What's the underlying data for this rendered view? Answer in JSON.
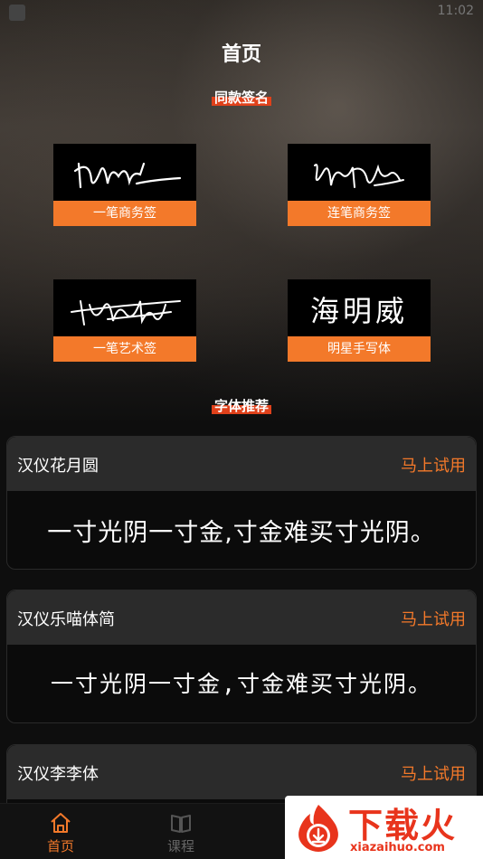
{
  "status": {
    "time": "11:02"
  },
  "header": {
    "title": "首页"
  },
  "signature_section": {
    "title": "同款签名",
    "cards": [
      {
        "label": "一笔商务签"
      },
      {
        "label": "连笔商务签"
      },
      {
        "label": "一笔艺术签"
      },
      {
        "label": "明星手写体",
        "sample_text": "海明威"
      }
    ]
  },
  "font_section": {
    "title": "字体推荐",
    "fonts": [
      {
        "name": "汉仪花月圆",
        "action": "马上试用",
        "sample": "一寸光阴一寸金,寸金难买寸光阴。"
      },
      {
        "name": "汉仪乐喵体简",
        "action": "马上试用",
        "sample": "一寸光阴一寸金,寸金难买寸光阴。"
      },
      {
        "name": "汉仪李李体",
        "action": "马上试用"
      }
    ]
  },
  "tabbar": {
    "items": [
      {
        "label": "首页",
        "icon": "home-icon",
        "active": true
      },
      {
        "label": "课程",
        "icon": "book-icon",
        "active": false
      }
    ]
  },
  "watermark": {
    "title": "下载火",
    "url": "xiazaihuo.com"
  },
  "colors": {
    "accent": "#f3792a",
    "tag_highlight": "#e0411b",
    "card_head": "#2b2b2b",
    "watermark_red": "#e8341c"
  }
}
